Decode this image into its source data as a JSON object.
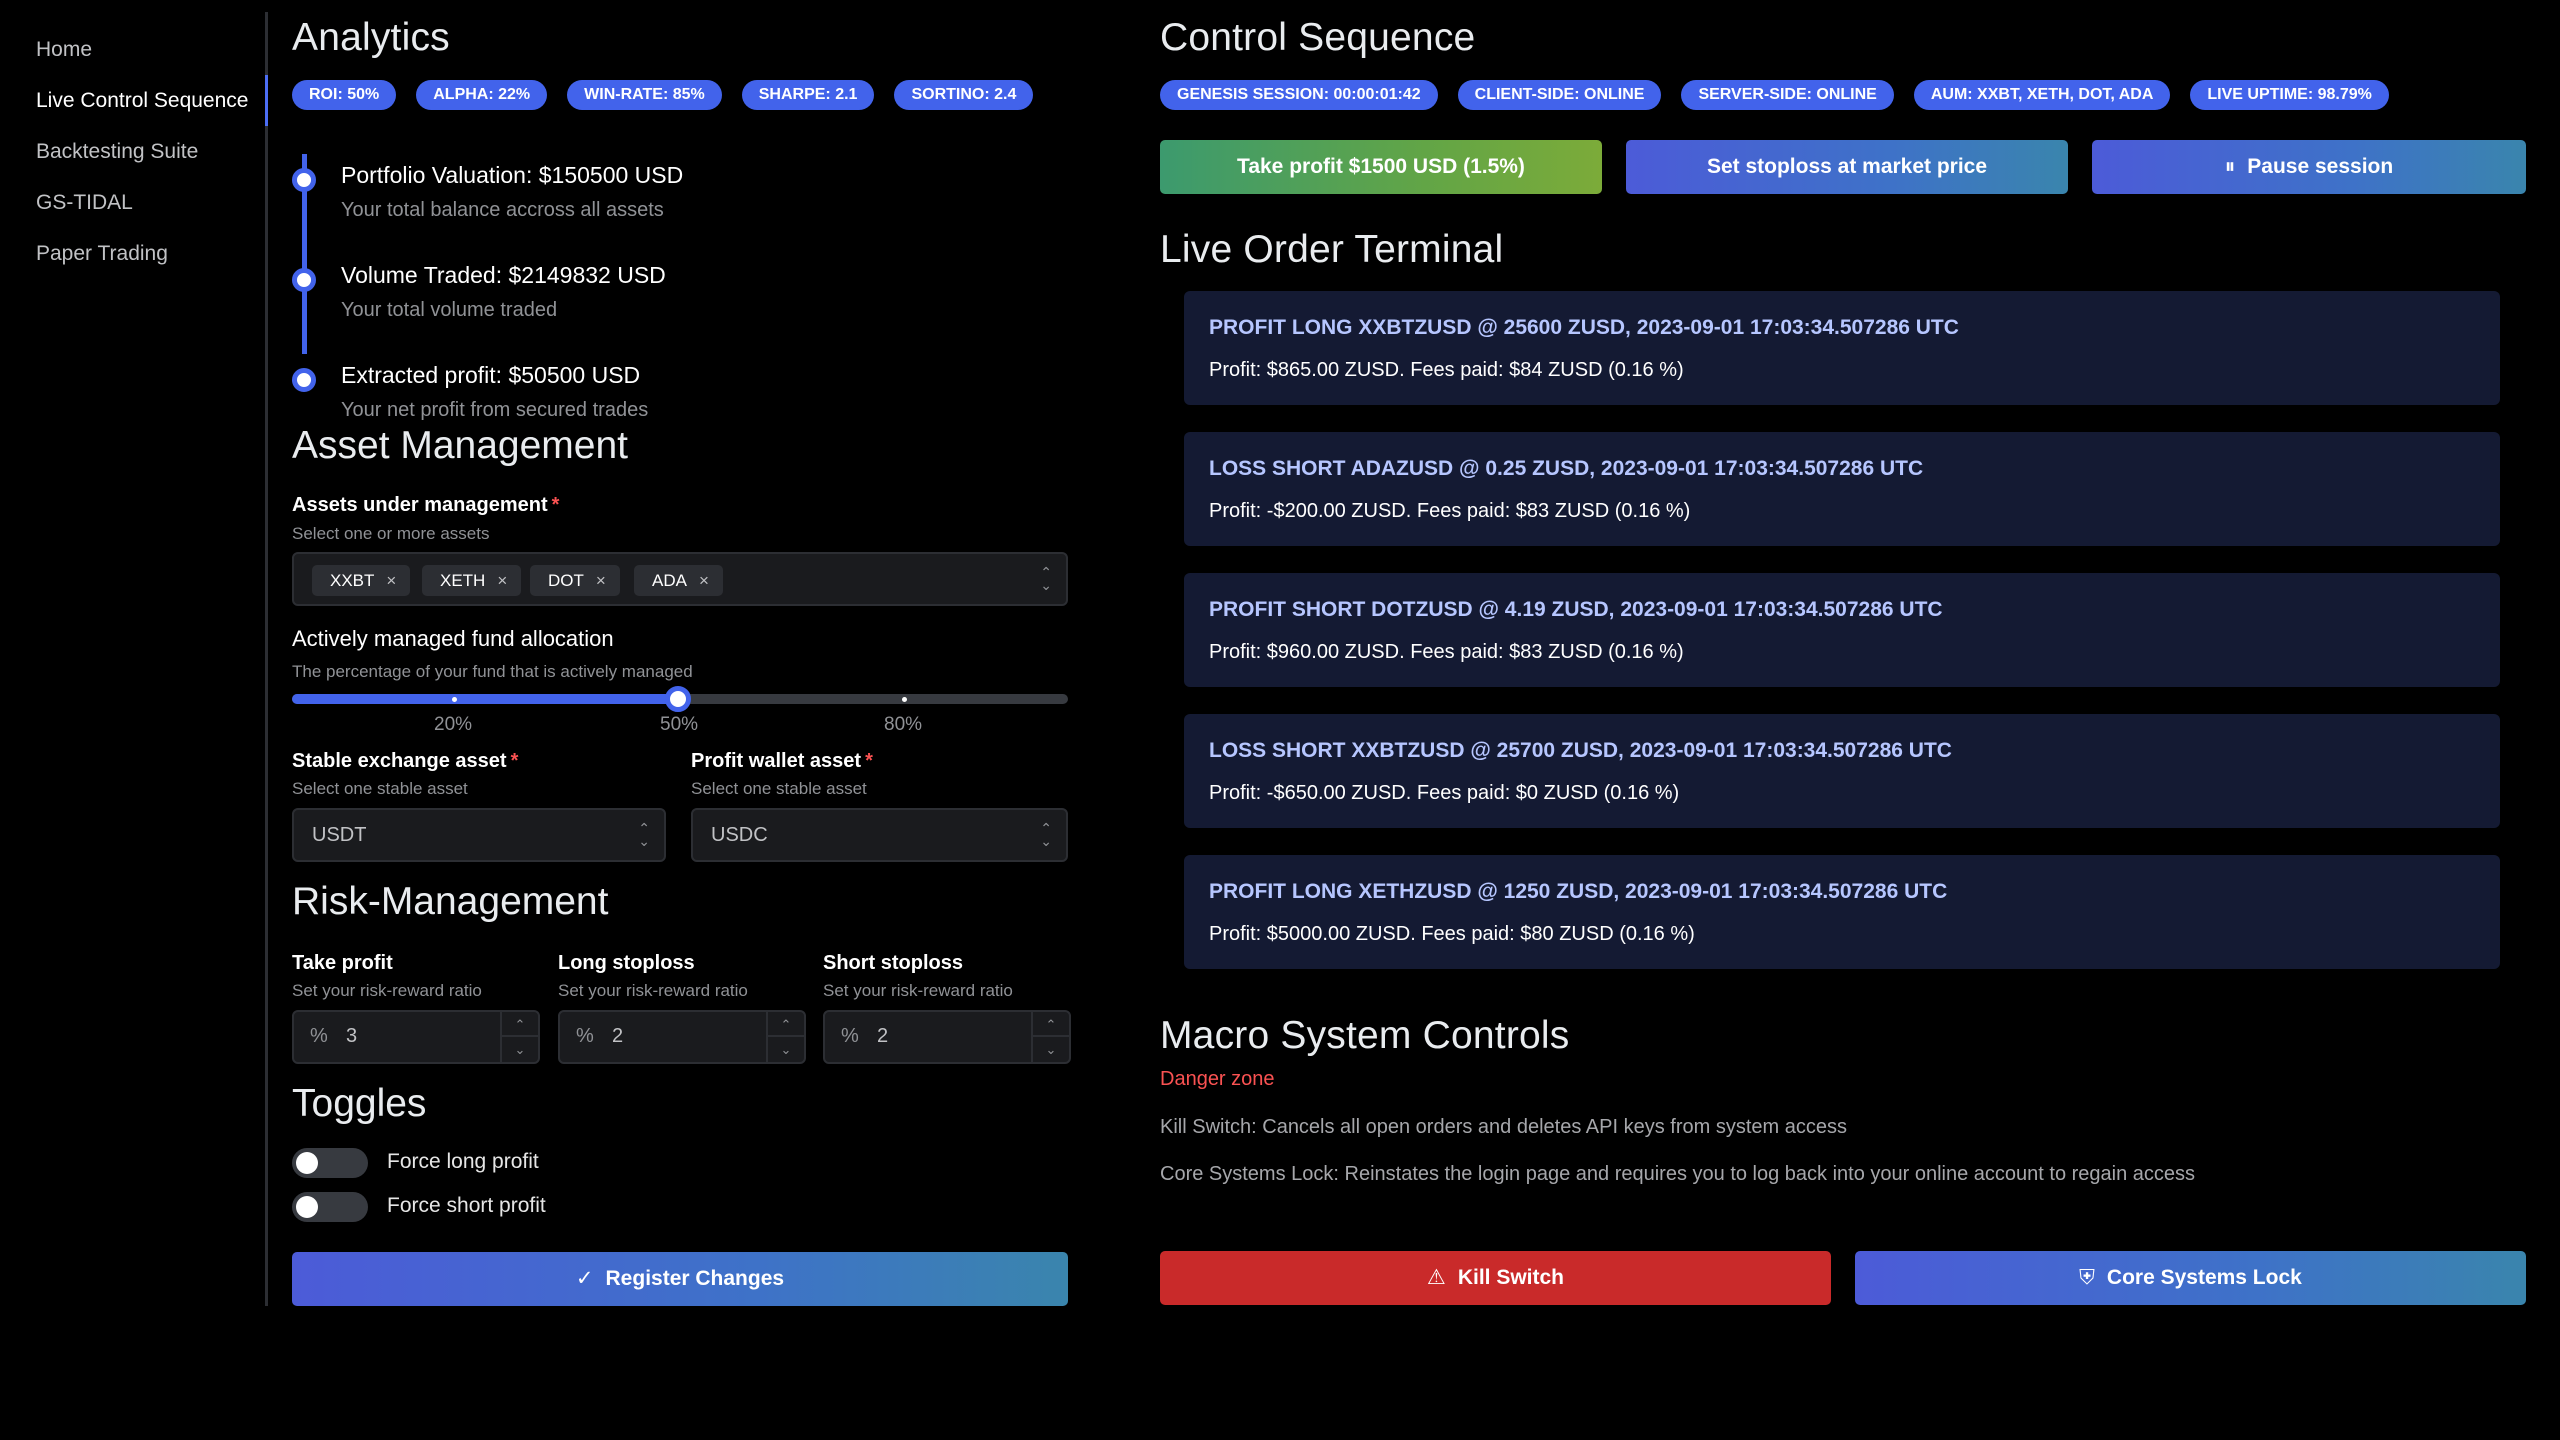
{
  "sidebar": {
    "items": [
      {
        "label": "Home"
      },
      {
        "label": "Live Control Sequence"
      },
      {
        "label": "Backtesting Suite"
      },
      {
        "label": "GS-TIDAL"
      },
      {
        "label": "Paper Trading"
      }
    ],
    "active_index": 1
  },
  "analytics": {
    "title": "Analytics",
    "badges": [
      "ROI: 50%",
      "ALPHA: 22%",
      "WIN-RATE: 85%",
      "SHARPE: 2.1",
      "SORTINO: 2.4"
    ],
    "timeline": [
      {
        "title": "Portfolio Valuation: $150500 USD",
        "desc": "Your total balance accross all assets"
      },
      {
        "title": "Volume Traded: $2149832 USD",
        "desc": "Your total volume traded"
      },
      {
        "title": "Extracted profit: $50500 USD",
        "desc": "Your net profit from secured trades"
      }
    ]
  },
  "asset_management": {
    "title": "Asset Management",
    "assets_label": "Assets under management",
    "assets_desc": "Select one or more assets",
    "assets": [
      "XXBT",
      "XETH",
      "DOT",
      "ADA"
    ],
    "remove_glyph": "×",
    "allocation_label": "Actively managed fund allocation",
    "allocation_desc": "The percentage of your fund that is actively managed",
    "allocation_value_pct": 50,
    "allocation_marks": [
      "20%",
      "50%",
      "80%"
    ],
    "stable_label": "Stable exchange asset",
    "stable_desc": "Select one stable asset",
    "stable_value": "USDT",
    "profit_wallet_label": "Profit wallet asset",
    "profit_wallet_desc": "Select one stable asset",
    "profit_wallet_value": "USDC",
    "required_mark": "*"
  },
  "risk_management": {
    "title": "Risk-Management",
    "fields": [
      {
        "label": "Take profit",
        "desc": "Set your risk-reward ratio",
        "prefix": "%",
        "value": "3"
      },
      {
        "label": "Long stoploss",
        "desc": "Set your risk-reward ratio",
        "prefix": "%",
        "value": "2"
      },
      {
        "label": "Short stoploss",
        "desc": "Set your risk-reward ratio",
        "prefix": "%",
        "value": "2"
      }
    ]
  },
  "toggles": {
    "title": "Toggles",
    "items": [
      {
        "label": "Force long profit",
        "on": false
      },
      {
        "label": "Force short profit",
        "on": false
      }
    ],
    "register_label": "Register Changes"
  },
  "control_sequence": {
    "title": "Control Sequence",
    "badges": [
      "GENESIS SESSION: 00:00:01:42",
      "CLIENT-SIDE: ONLINE",
      "SERVER-SIDE: ONLINE",
      "AUM: XXBT, XETH, DOT, ADA",
      "LIVE UPTIME: 98.79%"
    ],
    "take_profit_label": "Take profit $1500 USD (1.5%)",
    "stoploss_label": "Set stoploss at market price",
    "pause_label": "Pause session"
  },
  "order_terminal": {
    "title": "Live Order Terminal",
    "orders": [
      {
        "title": "PROFIT LONG XXBTZUSD @ 25600 ZUSD, 2023-09-01 17:03:34.507286 UTC",
        "body": "Profit: $865.00 ZUSD. Fees paid: $84 ZUSD (0.16 %)"
      },
      {
        "title": "LOSS SHORT ADAZUSD @ 0.25 ZUSD, 2023-09-01 17:03:34.507286 UTC",
        "body": "Profit: -$200.00 ZUSD. Fees paid: $83 ZUSD (0.16 %)"
      },
      {
        "title": "PROFIT SHORT DOTZUSD @ 4.19 ZUSD, 2023-09-01 17:03:34.507286 UTC",
        "body": "Profit: $960.00 ZUSD. Fees paid: $83 ZUSD (0.16 %)"
      },
      {
        "title": "LOSS SHORT XXBTZUSD @ 25700 ZUSD, 2023-09-01 17:03:34.507286 UTC",
        "body": "Profit: -$650.00 ZUSD. Fees paid: $0 ZUSD (0.16 %)"
      },
      {
        "title": "PROFIT LONG XETHZUSD @ 1250 ZUSD, 2023-09-01 17:03:34.507286 UTC",
        "body": "Profit: $5000.00 ZUSD. Fees paid: $80 ZUSD (0.16 %)"
      }
    ]
  },
  "macro": {
    "title": "Macro System Controls",
    "danger": "Danger zone",
    "kill_desc": "Kill Switch: Cancels all open orders and deletes API keys from system access",
    "lock_desc": "Core Systems Lock: Reinstates the login page and requires you to log back into your online account to regain access",
    "kill_label": "Kill Switch",
    "lock_label": "Core Systems Lock"
  },
  "colors": {
    "accent": "#4263eb",
    "danger": "#fa5252",
    "kill": "#c92a2a",
    "order_bg": "#141a33",
    "order_title": "#b6c6ff"
  }
}
